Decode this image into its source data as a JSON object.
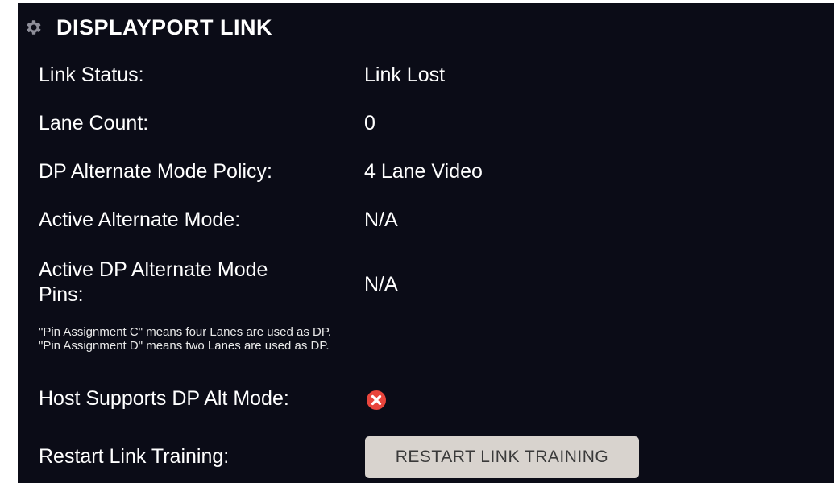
{
  "header": {
    "icon": "gear-icon",
    "title": "DISPLAYPORT LINK"
  },
  "rows": [
    {
      "label": "Link Status:",
      "value": "Link Lost"
    },
    {
      "label": "Lane Count:",
      "value": "0"
    },
    {
      "label": "DP Alternate Mode Policy:",
      "value": "4 Lane Video"
    },
    {
      "label": "Active Alternate Mode:",
      "value": "N/A"
    },
    {
      "label_line1": "Active DP Alternate Mode",
      "label_line2": "Pins:",
      "value": "N/A"
    }
  ],
  "notes": [
    "\"Pin Assignment C\" means four Lanes are used as DP.",
    "\"Pin Assignment D\" means two Lanes are used as DP."
  ],
  "host_support": {
    "label": "Host Supports DP Alt Mode:",
    "status_icon": "x-circle-icon",
    "status_color": "#e8453c"
  },
  "restart": {
    "label": "Restart Link Training:",
    "button_label": "RESTART LINK TRAINING"
  },
  "colors": {
    "panel_background": "#0b0c17",
    "button_background": "#d8d3ce",
    "text": "#ffffff"
  }
}
